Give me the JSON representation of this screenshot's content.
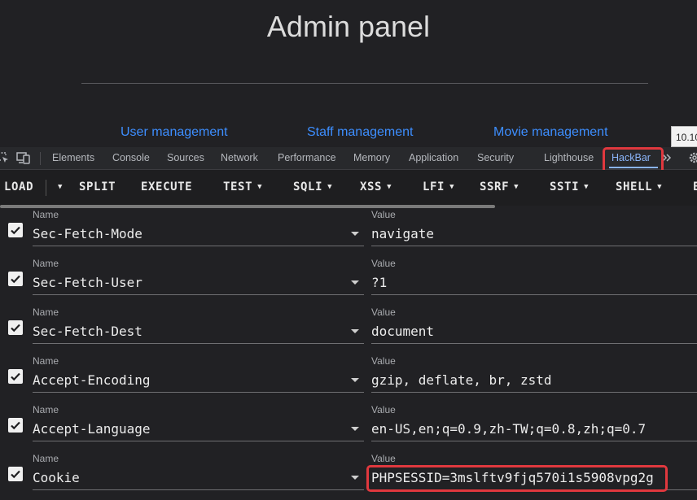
{
  "page": {
    "title": "Admin panel",
    "links": [
      "User management",
      "Staff management",
      "Movie management"
    ],
    "tooltip": "10.10"
  },
  "devtools": {
    "tabs": [
      "Elements",
      "Console",
      "Sources",
      "Network",
      "Performance",
      "Memory",
      "Application",
      "Security",
      "Lighthouse",
      "HackBar"
    ],
    "active_tab": "HackBar",
    "more_icon": "double-chevron-right-icon",
    "settings_icon": "gear-icon"
  },
  "hackbar": {
    "toolbar": {
      "load": "LOAD",
      "split": "SPLIT",
      "execute": "EXECUTE",
      "test": "TEST",
      "sqli": "SQLI",
      "xss": "XSS",
      "lfi": "LFI",
      "ssrf": "SSRF",
      "ssti": "SSTI",
      "shell": "SHELL",
      "overflow": "E"
    },
    "name_label": "Name",
    "value_label": "Value",
    "headers": [
      {
        "name": "Sec-Fetch-Mode",
        "value": "navigate",
        "enabled": true
      },
      {
        "name": "Sec-Fetch-User",
        "value": "?1",
        "enabled": true
      },
      {
        "name": "Sec-Fetch-Dest",
        "value": "document",
        "enabled": true
      },
      {
        "name": "Accept-Encoding",
        "value": "gzip, deflate, br, zstd",
        "enabled": true
      },
      {
        "name": "Accept-Language",
        "value": "en-US,en;q=0.9,zh-TW;q=0.8,zh;q=0.7",
        "enabled": true
      },
      {
        "name": "Cookie",
        "value": "PHPSESSID=3mslftv9fjq570i1s5908vpg2g",
        "enabled": true
      }
    ]
  },
  "colors": {
    "accent": "#8ab4f8",
    "link": "#3d8eff",
    "highlight": "#e0383e"
  }
}
